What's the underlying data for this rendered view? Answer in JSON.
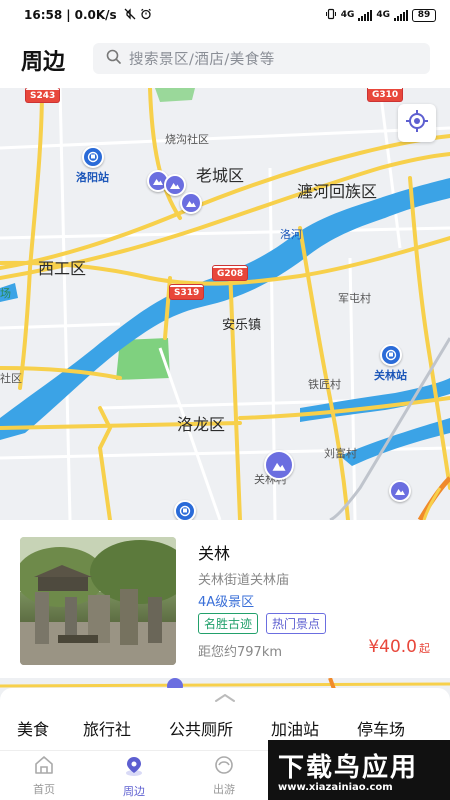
{
  "status_bar": {
    "time": "16:58",
    "network_speed": "0.0K/s",
    "signal_left": "4G",
    "signal_right": "4G",
    "battery": "89"
  },
  "header": {
    "title": "周边",
    "search_placeholder": "搜索景区/酒店/美食等"
  },
  "map": {
    "colors": {
      "water": "#3ba3e6",
      "land": "#eef0f3",
      "road_major": "#f7d04b",
      "road_minor": "#ffffff",
      "park": "#7fd17f",
      "poi_blue": "#2a6bd8",
      "poi_purple": "#6b6ee0"
    },
    "road_badges": [
      "S243",
      "G310",
      "G208",
      "S319"
    ],
    "districts": [
      "老城区",
      "瀍河回族区",
      "西工区",
      "洛龙区"
    ],
    "places": [
      "烧沟社区",
      "洛河",
      "安乐镇",
      "军屯村",
      "铁匠村",
      "刘富村",
      "关林村",
      "场",
      "社区"
    ],
    "stations": [
      "洛阳站",
      "关林站"
    ]
  },
  "card": {
    "name": "关林",
    "address": "关林街道关林庙",
    "level": "4A级景区",
    "tags": [
      "名胜古迹",
      "热门景点"
    ],
    "distance": "距您约797km",
    "price": "¥40.0",
    "price_suffix": "起"
  },
  "categories": [
    "美食",
    "旅行社",
    "公共厕所",
    "加油站",
    "停车场"
  ],
  "nav": {
    "items": [
      {
        "label": "首页",
        "icon": "home-icon"
      },
      {
        "label": "周边",
        "icon": "location-pin-icon"
      },
      {
        "label": "出游",
        "icon": "travel-icon"
      }
    ],
    "active": "周边"
  },
  "watermark": {
    "main": "下载鸟应用",
    "sub": "www.xiazainiao.com"
  }
}
